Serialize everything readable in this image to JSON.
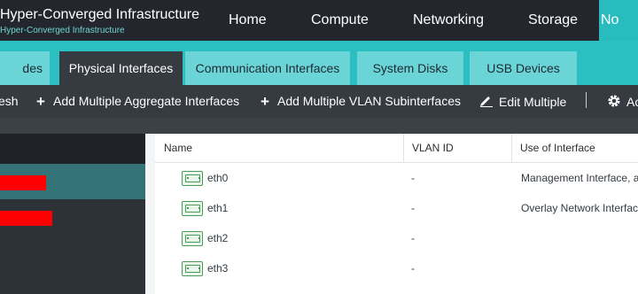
{
  "header": {
    "title": "Hyper-Converged Infrastructure",
    "subtitle": "Hyper-Converged Infrastructure",
    "nav": [
      "Home",
      "Compute",
      "Networking",
      "Storage",
      "No"
    ]
  },
  "tabs": [
    "des",
    "Physical Interfaces",
    "Communication Interfaces",
    "System Disks",
    "USB Devices"
  ],
  "toolbar": {
    "refresh": "esh",
    "add_aggregate": "Add Multiple Aggregate Interfaces",
    "add_vlan": "Add Multiple VLAN Subinterfaces",
    "edit_multiple": "Edit Multiple",
    "advanced": "Ac"
  },
  "table": {
    "columns": [
      "Name",
      "VLAN ID",
      "Use of Interface"
    ],
    "rows": [
      {
        "name": "eth0",
        "vlan": "-",
        "use": "Management Interface, a"
      },
      {
        "name": "eth1",
        "vlan": "-",
        "use": "Overlay Network Interfac"
      },
      {
        "name": "eth2",
        "vlan": "-",
        "use": ""
      },
      {
        "name": "eth3",
        "vlan": "-",
        "use": ""
      }
    ]
  },
  "colors": {
    "accent": "#2bbfc2",
    "header_bg": "#23272d",
    "toolbar_bg": "#363b42",
    "sidebar_selected": "#337377",
    "redaction": "#ff0000"
  }
}
